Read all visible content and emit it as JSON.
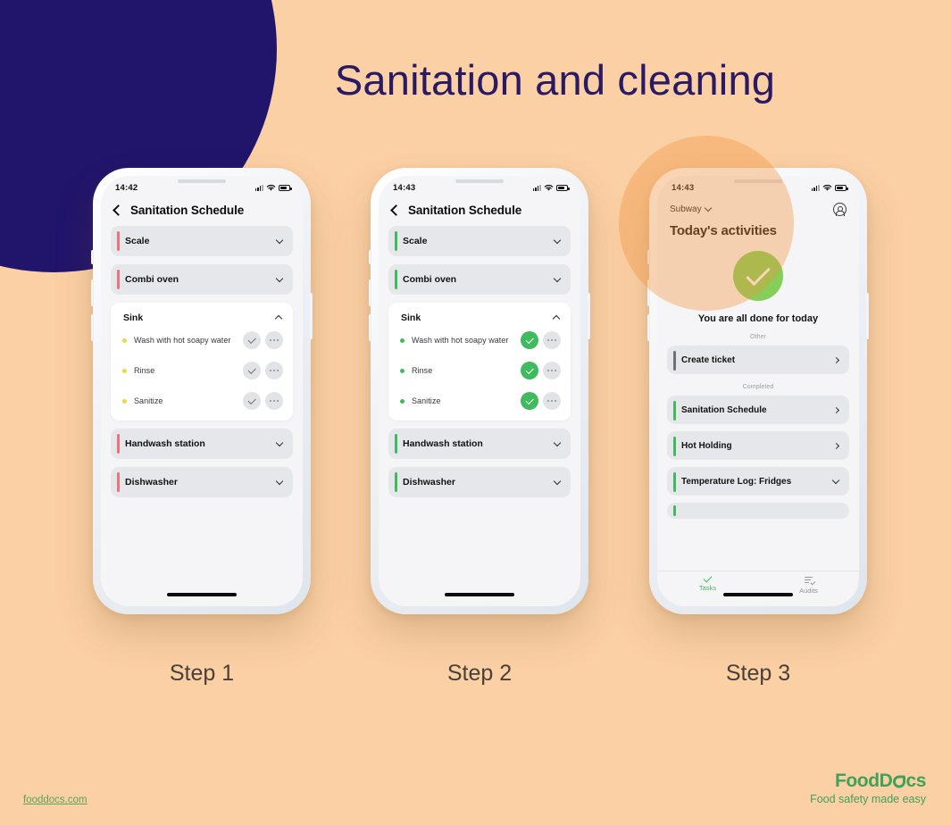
{
  "page": {
    "title": "Sanitation and cleaning",
    "background_color": "#FBD0A4",
    "accent_navy": "#21146B",
    "accent_green": "#3FBA5F",
    "accent_red": "#E8737B",
    "accent_yellow": "#F2D24A"
  },
  "footer": {
    "site_link": "fooddocs.com",
    "brand_name_part1": "Food",
    "brand_name_part2": "D",
    "brand_name_part3": "cs",
    "tagline": "Food safety made easy"
  },
  "steps": [
    {
      "caption": "Step 1"
    },
    {
      "caption": "Step 2"
    },
    {
      "caption": "Step 3"
    }
  ],
  "phone1": {
    "status": {
      "clock": "14:42"
    },
    "nav_title": "Sanitation Schedule",
    "rows_top": [
      {
        "label": "Scale",
        "accent": "red",
        "chevron": "chevron-down"
      },
      {
        "label": "Combi oven",
        "accent": "red",
        "chevron": "chevron-down"
      }
    ],
    "card": {
      "title": "Sink",
      "chevron": "chevron-up",
      "tasks": [
        {
          "label": "Wash with hot soapy water",
          "dot": "yellow",
          "state": "pending"
        },
        {
          "label": "Rinse",
          "dot": "yellow",
          "state": "pending"
        },
        {
          "label": "Sanitize",
          "dot": "yellow",
          "state": "pending"
        }
      ]
    },
    "rows_bottom": [
      {
        "label": "Handwash station",
        "accent": "red",
        "chevron": "chevron-down"
      },
      {
        "label": "Dishwasher",
        "accent": "red",
        "chevron": "chevron-down"
      }
    ]
  },
  "phone2": {
    "status": {
      "clock": "14:43"
    },
    "nav_title": "Sanitation Schedule",
    "rows_top": [
      {
        "label": "Scale",
        "accent": "green",
        "chevron": "chevron-down"
      },
      {
        "label": "Combi oven",
        "accent": "green",
        "chevron": "chevron-down"
      }
    ],
    "card": {
      "title": "Sink",
      "chevron": "chevron-up",
      "tasks": [
        {
          "label": "Wash with hot soapy water",
          "dot": "green",
          "state": "done"
        },
        {
          "label": "Rinse",
          "dot": "green",
          "state": "done"
        },
        {
          "label": "Sanitize",
          "dot": "green",
          "state": "done"
        }
      ]
    },
    "rows_bottom": [
      {
        "label": "Handwash station",
        "accent": "green",
        "chevron": "chevron-down"
      },
      {
        "label": "Dishwasher",
        "accent": "green",
        "chevron": "chevron-down"
      }
    ]
  },
  "phone3": {
    "status": {
      "clock": "14:43"
    },
    "location": "Subway",
    "heading": "Today's activities",
    "done_message": "You are all done for today",
    "sections": [
      {
        "label": "Other",
        "rows": [
          {
            "label": "Create ticket",
            "accent": "gray",
            "chevron": "chevron-right"
          }
        ]
      },
      {
        "label": "Completed",
        "rows": [
          {
            "label": "Sanitation Schedule",
            "accent": "green",
            "chevron": "chevron-right"
          },
          {
            "label": "Hot Holding",
            "accent": "green",
            "chevron": "chevron-right"
          },
          {
            "label": "Temperature Log: Fridges",
            "accent": "green",
            "chevron": "chevron-down"
          }
        ]
      }
    ],
    "tabs": [
      {
        "label": "Tasks",
        "icon": "check-icon",
        "active": true
      },
      {
        "label": "Audits",
        "icon": "audit-list-icon",
        "active": false
      }
    ]
  }
}
